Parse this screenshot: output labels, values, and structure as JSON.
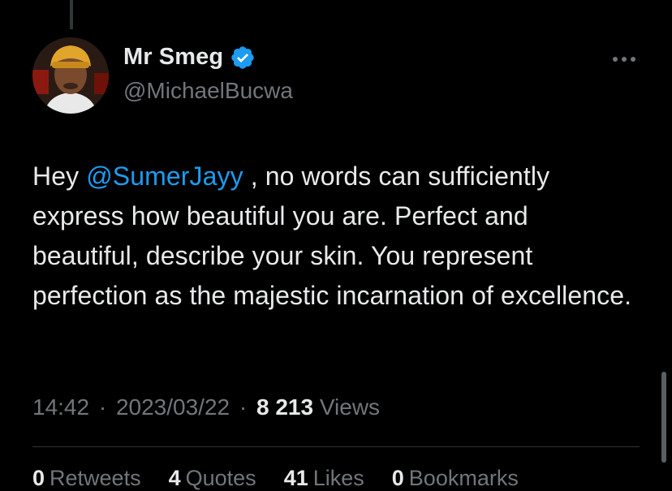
{
  "author": {
    "display_name": "Mr Smeg",
    "handle": "@MichaelBucwa",
    "avatar_icon": "user-avatar-photo",
    "verified": true
  },
  "tweet": {
    "text_before_mention": "Hey ",
    "mention": "@SumerJayy",
    "text_after_mention": " , no words can sufficiently express how beautiful you are. Perfect and beautiful, describe your skin. You represent perfection as the majestic incarnation of excellence."
  },
  "meta": {
    "time": "14:42",
    "separator": "·",
    "date": "2023/03/22",
    "views_count": "8 213",
    "views_label": "Views"
  },
  "stats": [
    {
      "count": "0",
      "label": "Retweets"
    },
    {
      "count": "4",
      "label": "Quotes"
    },
    {
      "count": "41",
      "label": "Likes"
    },
    {
      "count": "0",
      "label": "Bookmarks"
    }
  ],
  "colors": {
    "background": "#000000",
    "text": "#e7e9ea",
    "muted": "#71767b",
    "accent": "#1d9bf0",
    "divider": "#2f3336"
  }
}
